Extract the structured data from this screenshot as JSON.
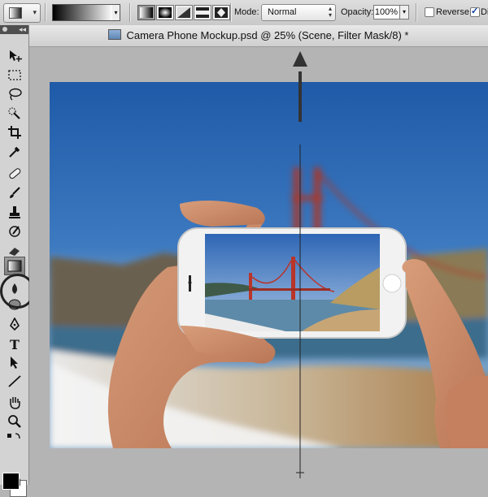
{
  "options_bar": {
    "mode_label": "Mode:",
    "mode_value": "Normal",
    "opacity_label": "Opacity:",
    "opacity_value": "100%",
    "reverse_label": "Reverse",
    "dither_label": "Di",
    "gradient_types": [
      "linear",
      "radial",
      "angle",
      "reflected",
      "diamond"
    ],
    "reverse_checked": false,
    "dither_checked": true
  },
  "document": {
    "title": "Camera Phone Mockup.psd @ 25% (Scene, Filter Mask/8) *"
  },
  "tools": {
    "items": [
      "move-tool",
      "marquee-tool",
      "lasso-tool",
      "quick-selection-tool",
      "crop-tool",
      "eyedropper-tool",
      "healing-brush-tool",
      "brush-tool",
      "clone-stamp-tool",
      "history-brush-tool",
      "eraser-tool",
      "gradient-tool",
      "blur-tool",
      "dodge-tool",
      "pen-tool",
      "type-tool",
      "path-selection-tool",
      "line-tool",
      "hand-tool",
      "zoom-tool"
    ],
    "selected": "gradient-tool",
    "foreground_color": "#000000",
    "background_color": "#ffffff"
  },
  "colors": {
    "toolbar_bg": "#d3d3d3",
    "canvas_bg": "#b4b4b4",
    "annotation": "#222222"
  }
}
